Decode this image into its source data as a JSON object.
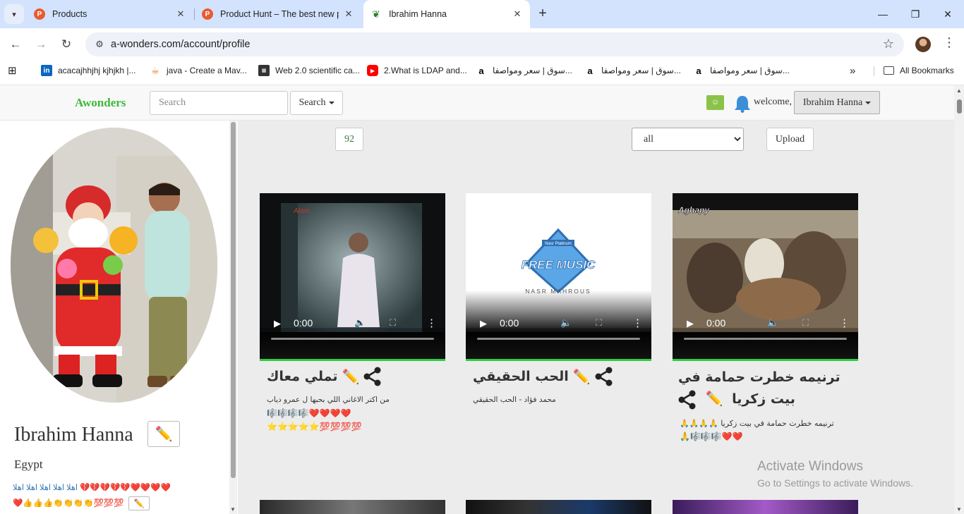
{
  "browser": {
    "tabs": [
      {
        "title": "Products",
        "favicon": "P"
      },
      {
        "title": "Product Hunt – The best new p",
        "favicon": "P"
      },
      {
        "title": "Ibrahim Hanna",
        "favicon": "leaf"
      }
    ],
    "url": "a-wonders.com/account/profile",
    "bookmarks": [
      {
        "label": "acacajhhjhj kjhjkh |...",
        "icon": "linkedin-icon"
      },
      {
        "label": "java - Create a Mav...",
        "icon": "java-icon"
      },
      {
        "label": "Web 2.0 scientific ca...",
        "icon": "calculator-icon"
      },
      {
        "label": "2.What is LDAP and...",
        "icon": "youtube-icon"
      },
      {
        "label": "سوق | سعر ومواصفا...",
        "icon": "amazon-icon"
      },
      {
        "label": "سوق | سعر ومواصفا...",
        "icon": "amazon-icon"
      },
      {
        "label": "سوق | سعر ومواصفا...",
        "icon": "amazon-icon"
      }
    ],
    "all_bookmarks": "All Bookmarks"
  },
  "site": {
    "brand": "Awonders",
    "search_placeholder": "Search",
    "search_button": "Search",
    "welcome": "welcome,",
    "user_menu": "Ibrahim Hanna"
  },
  "profile": {
    "name": "Ibrahim Hanna",
    "country": "Egypt",
    "bio_text": "اهلا اهلا اهلا اهلا اهلا",
    "bio_emojis_1": "💔💔💔💔💔❤️❤️❤️❤️",
    "bio_emojis_2": "❤️👍👍👍👏👏👏👏💯💯💯"
  },
  "toolbar": {
    "count": "92",
    "filter_selected": "all",
    "upload": "Upload"
  },
  "videos": [
    {
      "title": "تملي معاك",
      "description": "من اكتر الاغاني اللي بحبها ل عمرو دياب",
      "emojis": "🎼🎼🎼🎼❤️❤️❤️❤️ ⭐⭐⭐⭐⭐💯💯💯💯",
      "time": "0:00",
      "thumb_label": "Alam"
    },
    {
      "title": "الحب الحقيقي",
      "description": "محمد فؤاد - الحب الحقيقي",
      "emojis": "",
      "time": "0:00",
      "thumb_label": "FREE MUSIC",
      "thumb_sub": "NASR MAHROUS",
      "thumb_top": "Nasr Platinum"
    },
    {
      "title": "ترنيمه خطرت حمامة في بيت زكريا",
      "description": "ترنيمه خطرت حمامة في بيت زكريا 🙏🙏🙏🙏",
      "emojis": "🙏🎼🎼🎼❤️❤️",
      "time": "0:00",
      "thumb_label": "Aghapy"
    }
  ],
  "watermark": {
    "line1": "Activate Windows",
    "line2": "Go to Settings to activate Windows."
  }
}
